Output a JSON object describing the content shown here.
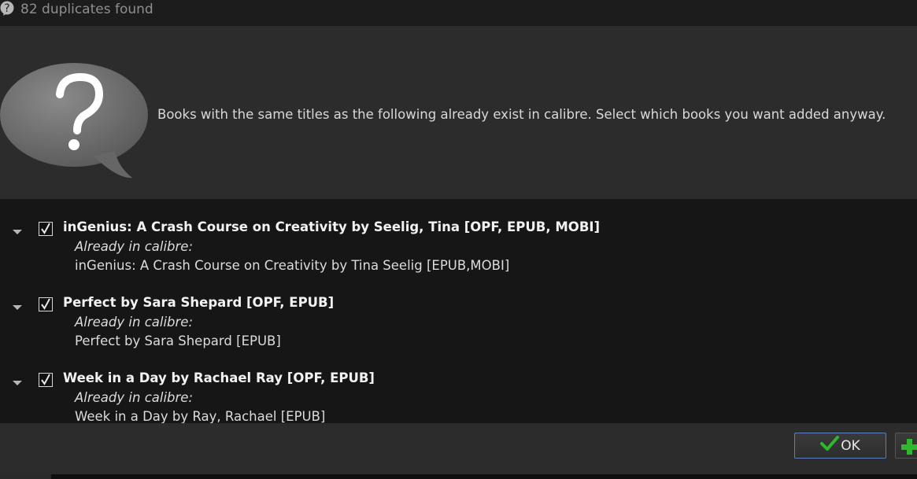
{
  "window": {
    "title": "82 duplicates found",
    "title_icon": "question-mark-icon"
  },
  "header": {
    "icon": "question-bubble-icon",
    "message": "Books with the same titles as the following already exist in calibre. Select which books you want added anyway."
  },
  "items": [
    {
      "checked": true,
      "title": "inGenius: A Crash Course on Creativity by Seelig, Tina [OPF, EPUB, MOBI]",
      "already_label": "Already in calibre:",
      "existing": "inGenius: A Crash Course on Creativity by Tina Seelig [EPUB,MOBI]"
    },
    {
      "checked": true,
      "title": "Perfect by Sara Shepard [OPF, EPUB]",
      "already_label": "Already in calibre:",
      "existing": "Perfect by Sara Shepard [EPUB]"
    },
    {
      "checked": true,
      "title": "Week in a Day by Rachael Ray [OPF, EPUB]",
      "already_label": "Already in calibre:",
      "existing": "Week in a Day by Ray, Rachael [EPUB]"
    }
  ],
  "footer": {
    "ok_label": "OK",
    "ok_icon": "green-check-icon",
    "next_icon": "green-plus-icon"
  },
  "colors": {
    "accent_check": "#2eb82e",
    "button_border": "#5a7fbf"
  }
}
